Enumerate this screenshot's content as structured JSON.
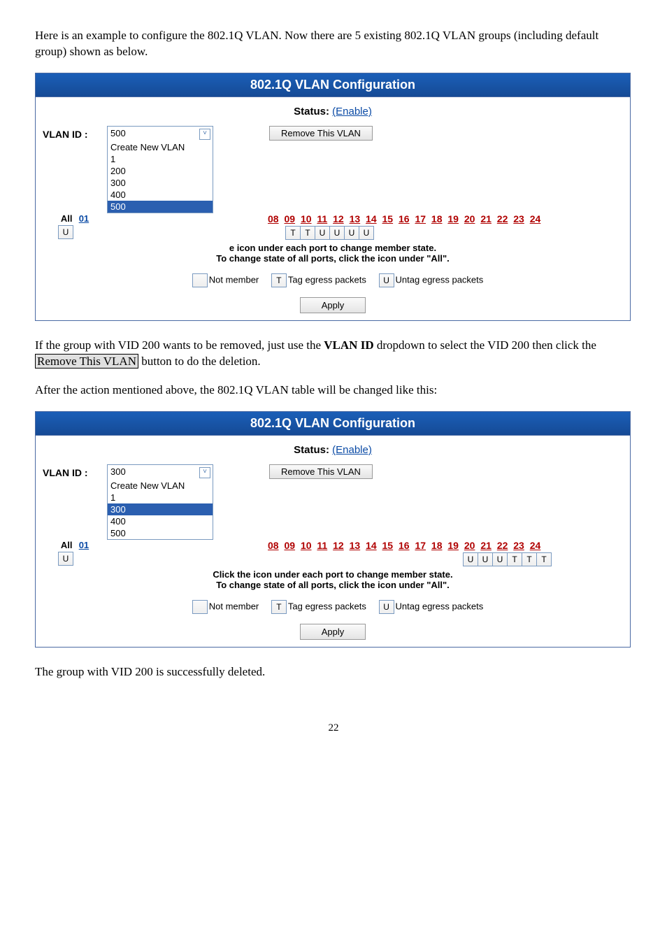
{
  "intro": "Here is an example to configure the 802.1Q VLAN. Now there are 5 existing 802.1Q VLAN groups (including default group) shown as below.",
  "panel": {
    "title": "802.1Q VLAN Configuration",
    "status_label": "Status:",
    "status_value": "(Enable)",
    "vlanid_label": "VLAN ID :",
    "remove_btn": "Remove This VLAN",
    "all_label": "All",
    "all_link": "01",
    "all_box": "U",
    "hint1_partial": "e icon under each port to change member state.",
    "hint1_full": "Click the icon under each port to change member state.",
    "hint2": "To change state of all ports, click the icon under \"All\".",
    "legend": {
      "not_member": "Not member",
      "tag": "Tag egress packets",
      "untag": "Untag egress packets",
      "t": "T",
      "u": "U"
    },
    "apply": "Apply"
  },
  "panel1": {
    "selected": "500",
    "options": [
      "Create New VLAN",
      "1",
      "200",
      "300",
      "400",
      "500"
    ],
    "selected_index": 5,
    "port_headers": [
      "08",
      "09",
      "10",
      "11",
      "12",
      "13",
      "14",
      "15",
      "16",
      "17",
      "18",
      "19",
      "20",
      "21",
      "22",
      "23",
      "24"
    ],
    "port_vals": [
      "",
      "",
      "T",
      "T",
      "U",
      "U",
      "U",
      "U",
      "",
      "",
      "",
      "",
      "",
      "",
      "",
      "",
      ""
    ]
  },
  "mid1_a": "If the group with VID 200 wants to be removed, just use the ",
  "mid1_bold": "VLAN ID",
  "mid1_b": " dropdown to select the VID 200 then click the ",
  "mid1_btn": "Remove This VLAN",
  "mid1_c": " button to do the deletion.",
  "mid2": "After the action mentioned above, the 802.1Q VLAN table will be changed like this:",
  "panel2": {
    "selected": "300",
    "options": [
      "Create New VLAN",
      "1",
      "300",
      "400",
      "500"
    ],
    "selected_index": 2,
    "port_headers": [
      "08",
      "09",
      "10",
      "11",
      "12",
      "13",
      "14",
      "15",
      "16",
      "17",
      "18",
      "19",
      "20",
      "21",
      "22",
      "23",
      "24"
    ],
    "port_vals": [
      "",
      "",
      "",
      "",
      "",
      "",
      "",
      "",
      "",
      "",
      "",
      "U",
      "U",
      "U",
      "T",
      "T",
      "T"
    ]
  },
  "outro": "The group with VID 200 is successfully deleted.",
  "page_num": "22"
}
